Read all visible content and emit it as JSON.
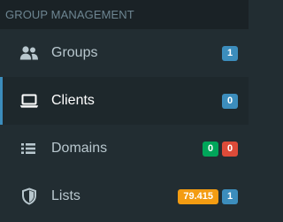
{
  "header": {
    "title": "GROUP MANAGEMENT"
  },
  "colors": {
    "blue": "#3c8dbc",
    "green": "#00a65a",
    "red": "#dd4b39",
    "orange": "#f39c12"
  },
  "menu": {
    "items": [
      {
        "label": "Groups",
        "icon": "users-icon",
        "active": false,
        "badges": [
          {
            "value": "1",
            "color": "#3c8dbc"
          }
        ]
      },
      {
        "label": "Clients",
        "icon": "laptop-icon",
        "active": true,
        "badges": [
          {
            "value": "0",
            "color": "#3c8dbc"
          }
        ]
      },
      {
        "label": "Domains",
        "icon": "list-icon",
        "active": false,
        "badges": [
          {
            "value": "0",
            "color": "#00a65a"
          },
          {
            "value": "0",
            "color": "#dd4b39"
          }
        ]
      },
      {
        "label": "Lists",
        "icon": "shield-icon",
        "active": false,
        "badges": [
          {
            "value": "79.415",
            "color": "#f39c12"
          },
          {
            "value": "1",
            "color": "#3c8dbc"
          }
        ]
      }
    ]
  }
}
